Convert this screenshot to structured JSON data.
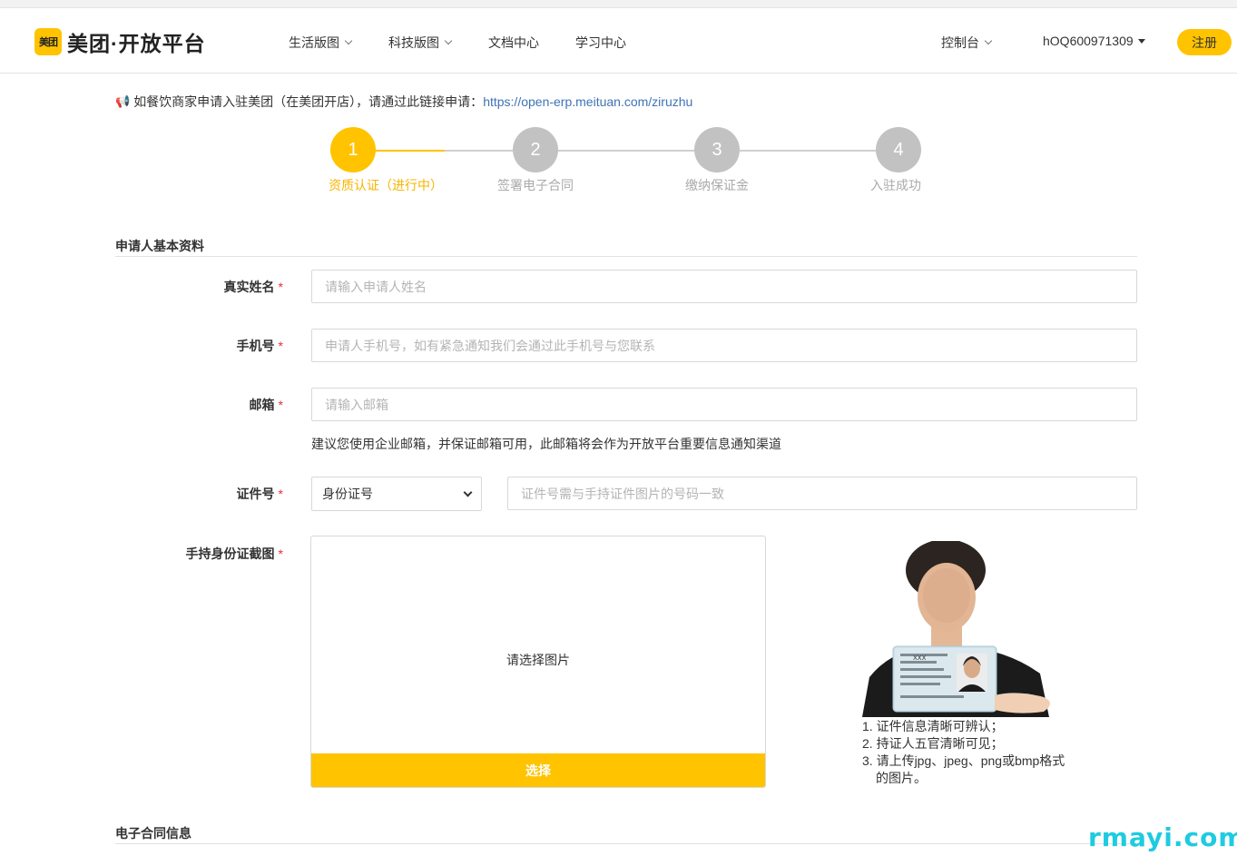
{
  "header": {
    "logo_badge": "美团",
    "logo_text": "美团·开放平台",
    "nav": [
      {
        "label": "生活版图"
      },
      {
        "label": "科技版图"
      },
      {
        "label": "文档中心"
      },
      {
        "label": "学习中心"
      }
    ],
    "console_label": "控制台",
    "username": "hOQ600971309",
    "register_label": "注册"
  },
  "notice": {
    "text": "如餐饮商家申请入驻美团（在美团开店），请通过此链接申请：",
    "link": "https://open-erp.meituan.com/ziruzhu"
  },
  "steps": [
    {
      "num": "1",
      "label": "资质认证（进行中）",
      "active": true
    },
    {
      "num": "2",
      "label": "签署电子合同",
      "active": false
    },
    {
      "num": "3",
      "label": "缴纳保证金",
      "active": false
    },
    {
      "num": "4",
      "label": "入驻成功",
      "active": false
    }
  ],
  "section1": {
    "title": "申请人基本资料"
  },
  "form": {
    "name": {
      "label": "真实姓名",
      "placeholder": "请输入申请人姓名"
    },
    "phone": {
      "label": "手机号",
      "placeholder": "申请人手机号，如有紧急通知我们会通过此手机号与您联系"
    },
    "email": {
      "label": "邮箱",
      "placeholder": "请输入邮箱",
      "hint": "建议您使用企业邮箱，并保证邮箱可用，此邮箱将会作为开放平台重要信息通知渠道"
    },
    "id": {
      "label": "证件号",
      "select_value": "身份证号",
      "placeholder": "证件号需与手持证件图片的号码一致"
    },
    "idphoto": {
      "label": "手持身份证截图",
      "upload_text": "请选择图片",
      "choose_label": "选择",
      "card_name": "XXX",
      "tips": [
        "1. 证件信息清晰可辨认；",
        "2. 持证人五官清晰可见；",
        "3. 请上传jpg、jpeg、png或bmp格式的图片。"
      ]
    }
  },
  "section2": {
    "title": "电子合同信息"
  },
  "required_mark": "*",
  "watermark": "rmayi.com",
  "colors": {
    "accent": "#ffc300",
    "link": "#3f73b4",
    "required": "#e5312d",
    "inactive_step": "#c2c2c2"
  }
}
